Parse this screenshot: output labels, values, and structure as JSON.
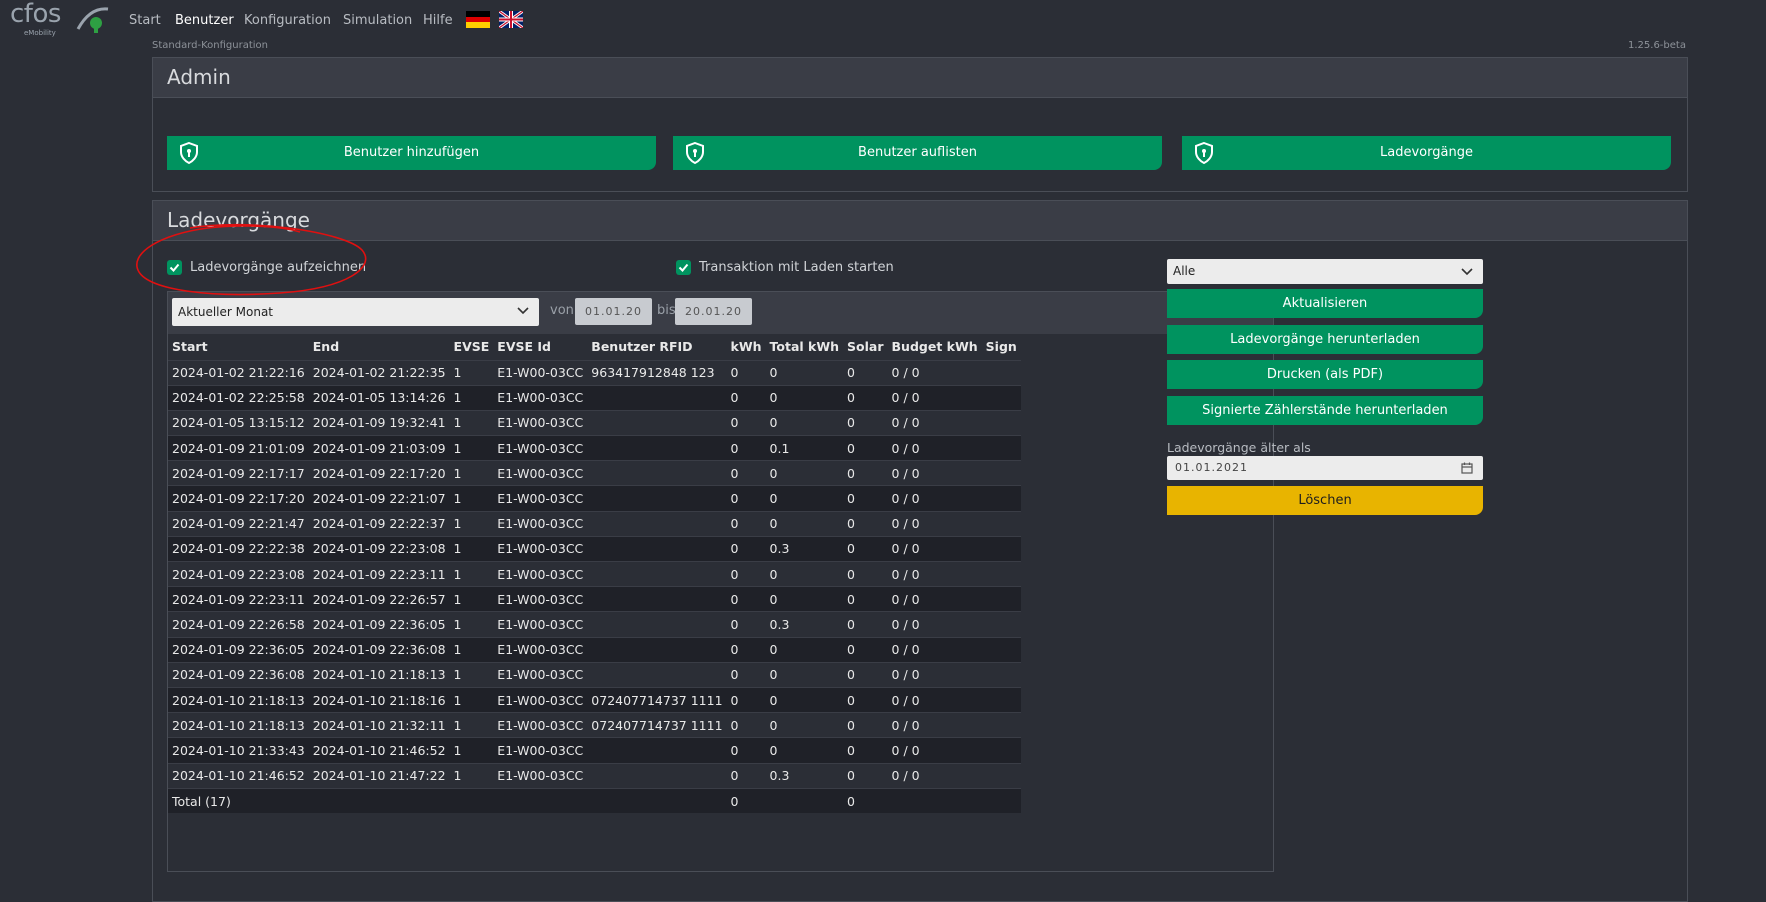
{
  "brand": {
    "name": "cfos",
    "sub": "eMobility"
  },
  "nav": {
    "items": [
      "Start",
      "Benutzer",
      "Konfiguration",
      "Simulation",
      "Hilfe"
    ],
    "active": "Benutzer"
  },
  "subheader": {
    "left": "Standard-Konfiguration",
    "right": "1.25.6-beta"
  },
  "admin": {
    "title": "Admin",
    "buttons": [
      "Benutzer hinzufügen",
      "Benutzer auflisten",
      "Ladevorgänge"
    ]
  },
  "lade": {
    "title": "Ladevorgänge",
    "record_checkbox_label": "Ladevorgänge aufzeichnen",
    "record_checked": true,
    "transaction_checkbox_label": "Transaktion mit Laden starten",
    "transaction_checked": true,
    "period_select": "Aktueller Monat",
    "from_label": "von",
    "from_date": "01.01.20",
    "to_label": "bis",
    "to_date": "20.01.20",
    "columns": [
      "Start",
      "End",
      "EVSE",
      "EVSE Id",
      "Benutzer RFID",
      "kWh",
      "Total kWh",
      "Solar",
      "Budget kWh",
      "Sign"
    ],
    "rows": [
      [
        "2024-01-02 21:22:16",
        "2024-01-02 21:22:35",
        "1",
        "E1-W00-03CC",
        "963417912848 123",
        "0",
        "0",
        "0",
        "0 / 0",
        ""
      ],
      [
        "2024-01-02 22:25:58",
        "2024-01-05 13:14:26",
        "1",
        "E1-W00-03CC",
        "",
        "0",
        "0",
        "0",
        "0 / 0",
        ""
      ],
      [
        "2024-01-05 13:15:12",
        "2024-01-09 19:32:41",
        "1",
        "E1-W00-03CC",
        "",
        "0",
        "0",
        "0",
        "0 / 0",
        ""
      ],
      [
        "2024-01-09 21:01:09",
        "2024-01-09 21:03:09",
        "1",
        "E1-W00-03CC",
        "",
        "0",
        "0.1",
        "0",
        "0 / 0",
        ""
      ],
      [
        "2024-01-09 22:17:17",
        "2024-01-09 22:17:20",
        "1",
        "E1-W00-03CC",
        "",
        "0",
        "0",
        "0",
        "0 / 0",
        ""
      ],
      [
        "2024-01-09 22:17:20",
        "2024-01-09 22:21:07",
        "1",
        "E1-W00-03CC",
        "",
        "0",
        "0",
        "0",
        "0 / 0",
        ""
      ],
      [
        "2024-01-09 22:21:47",
        "2024-01-09 22:22:37",
        "1",
        "E1-W00-03CC",
        "",
        "0",
        "0",
        "0",
        "0 / 0",
        ""
      ],
      [
        "2024-01-09 22:22:38",
        "2024-01-09 22:23:08",
        "1",
        "E1-W00-03CC",
        "",
        "0",
        "0.3",
        "0",
        "0 / 0",
        ""
      ],
      [
        "2024-01-09 22:23:08",
        "2024-01-09 22:23:11",
        "1",
        "E1-W00-03CC",
        "",
        "0",
        "0",
        "0",
        "0 / 0",
        ""
      ],
      [
        "2024-01-09 22:23:11",
        "2024-01-09 22:26:57",
        "1",
        "E1-W00-03CC",
        "",
        "0",
        "0",
        "0",
        "0 / 0",
        ""
      ],
      [
        "2024-01-09 22:26:58",
        "2024-01-09 22:36:05",
        "1",
        "E1-W00-03CC",
        "",
        "0",
        "0.3",
        "0",
        "0 / 0",
        ""
      ],
      [
        "2024-01-09 22:36:05",
        "2024-01-09 22:36:08",
        "1",
        "E1-W00-03CC",
        "",
        "0",
        "0",
        "0",
        "0 / 0",
        ""
      ],
      [
        "2024-01-09 22:36:08",
        "2024-01-10 21:18:13",
        "1",
        "E1-W00-03CC",
        "",
        "0",
        "0",
        "0",
        "0 / 0",
        ""
      ],
      [
        "2024-01-10 21:18:13",
        "2024-01-10 21:18:16",
        "1",
        "E1-W00-03CC",
        "072407714737 1111",
        "0",
        "0",
        "0",
        "0 / 0",
        ""
      ],
      [
        "2024-01-10 21:18:13",
        "2024-01-10 21:32:11",
        "1",
        "E1-W00-03CC",
        "072407714737 1111",
        "0",
        "0",
        "0",
        "0 / 0",
        ""
      ],
      [
        "2024-01-10 21:33:43",
        "2024-01-10 21:46:52",
        "1",
        "E1-W00-03CC",
        "",
        "0",
        "0",
        "0",
        "0 / 0",
        ""
      ],
      [
        "2024-01-10 21:46:52",
        "2024-01-10 21:47:22",
        "1",
        "E1-W00-03CC",
        "",
        "0",
        "0.3",
        "0",
        "0 / 0",
        ""
      ]
    ],
    "total_row": [
      "Total (17)",
      "",
      "",
      "",
      "",
      "0",
      "",
      "0",
      "",
      ""
    ],
    "side": {
      "filter_select": "Alle",
      "buttons": [
        "Aktualisieren",
        "Ladevorgänge herunterladen",
        "Drucken (als PDF)",
        "Signierte Zählerstände herunterladen"
      ],
      "older_label": "Ladevorgänge älter als",
      "older_date": "01.01.2021",
      "delete_button": "Löschen"
    }
  },
  "colors": {
    "green": "#00935f",
    "yellow": "#e8b400",
    "background": "#2b2e36",
    "annotation": "#e01010"
  }
}
